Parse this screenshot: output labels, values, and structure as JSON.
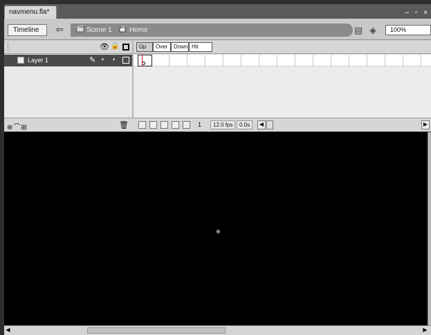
{
  "document": {
    "tab_title": "navmenu.fla*",
    "window_controls": "– ▫ ×"
  },
  "editbar": {
    "timeline_label": "Timeline",
    "back_icon": "⇦",
    "scene_label": "Scene 1",
    "symbol_label": "Home",
    "zoom_value": "100%"
  },
  "layers": {
    "header_icons": {
      "eye": "👁",
      "lock": "🔒"
    },
    "items": [
      {
        "name": "Layer 1"
      }
    ]
  },
  "frame_labels": [
    "Up",
    "Over",
    "Down",
    "Hit"
  ],
  "timeline_footer": {
    "current_frame": "1",
    "fps": "12.0 fps",
    "elapsed": "0.0s",
    "add_layer_icons": "⊕⌒⊞",
    "trash_icon": "🗑"
  },
  "icons": [
    "document-icon",
    "back-arrow-icon",
    "scene-icon",
    "symbol-icon",
    "edit-scene-icon",
    "edit-symbol-icon",
    "eye-icon",
    "lock-icon",
    "outline-icon",
    "pencil-icon",
    "trash-icon",
    "registration-point-icon"
  ],
  "colors": {
    "stage": "#000000",
    "playhead": "#dd2222",
    "selected_layer": "#4a4a4a"
  }
}
